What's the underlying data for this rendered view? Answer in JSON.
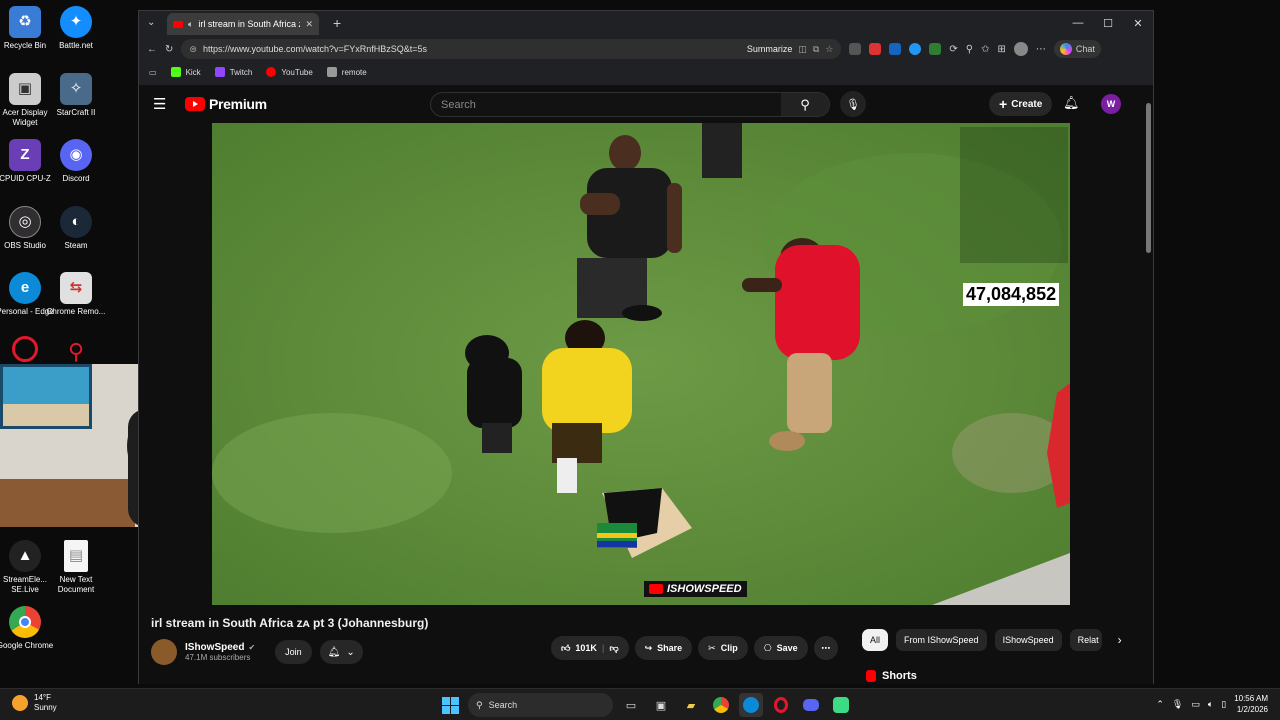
{
  "desktop": {
    "icons": [
      {
        "label": "Recycle Bin",
        "glyph": "♻",
        "color": "#3a7bd5"
      },
      {
        "label": "Battle.net",
        "glyph": "✦",
        "color": "#148eff"
      },
      {
        "label": "Acer Display Widget",
        "glyph": "▣",
        "color": "#cccccc"
      },
      {
        "label": "StarCraft II",
        "glyph": "✧",
        "color": "#4a6a8a"
      },
      {
        "label": "CPUID CPU-Z",
        "glyph": "Z",
        "color": "#6a3fb5"
      },
      {
        "label": "Discord",
        "glyph": "◉",
        "color": "#5865f2"
      },
      {
        "label": "OBS Studio",
        "glyph": "◎",
        "color": "#302e31"
      },
      {
        "label": "Steam",
        "glyph": "◐",
        "color": "#1b2838"
      },
      {
        "label": "Personal - Edge",
        "glyph": "e",
        "color": "#0c8ad8"
      },
      {
        "label": "Chrome Remo...",
        "glyph": "⇆",
        "color": "#e0e0e0"
      },
      {
        "label": "StreamEle... SE.Live",
        "glyph": "▲",
        "color": "#222222"
      },
      {
        "label": "New Text Document",
        "glyph": "▤",
        "color": "#f5f5f5"
      },
      {
        "label": "Google Chrome",
        "glyph": "◍",
        "color": "#ea4335"
      }
    ]
  },
  "browser": {
    "tab_title": "irl stream in South Africa ᴢᴀ pt",
    "url": "https://www.youtube.com/watch?v=FYxRnfHBzSQ&t=5s",
    "summarize_label": "Summarize",
    "chat_label": "Chat",
    "favorites": [
      {
        "label": "Kick",
        "color": "#53fc18"
      },
      {
        "label": "Twitch",
        "color": "#9146ff"
      },
      {
        "label": "YouTube",
        "color": "#ff0000"
      },
      {
        "label": "remote",
        "color": "#999999"
      }
    ]
  },
  "youtube": {
    "logo_text": "Premium",
    "search_placeholder": "Search",
    "create_label": "Create",
    "avatar_letter": "W",
    "video": {
      "title": "irl stream in South Africa ᴢᴀ pt 3 (Johannesburg)",
      "view_counter": "47,084,852",
      "watermark": "ISHOWSPEED"
    },
    "channel": {
      "name": "IShowSpeed",
      "subscribers": "47.1M subscribers",
      "join_label": "Join"
    },
    "actions": {
      "likes": "101K",
      "share": "Share",
      "clip": "Clip",
      "save": "Save"
    },
    "chips": [
      "All",
      "From IShowSpeed",
      "IShowSpeed",
      "Relat"
    ],
    "shorts_label": "Shorts"
  },
  "taskbar": {
    "temperature": "14°F",
    "condition": "Sunny",
    "search_label": "Search",
    "time": "10:56 AM",
    "date": "1/2/2026"
  }
}
